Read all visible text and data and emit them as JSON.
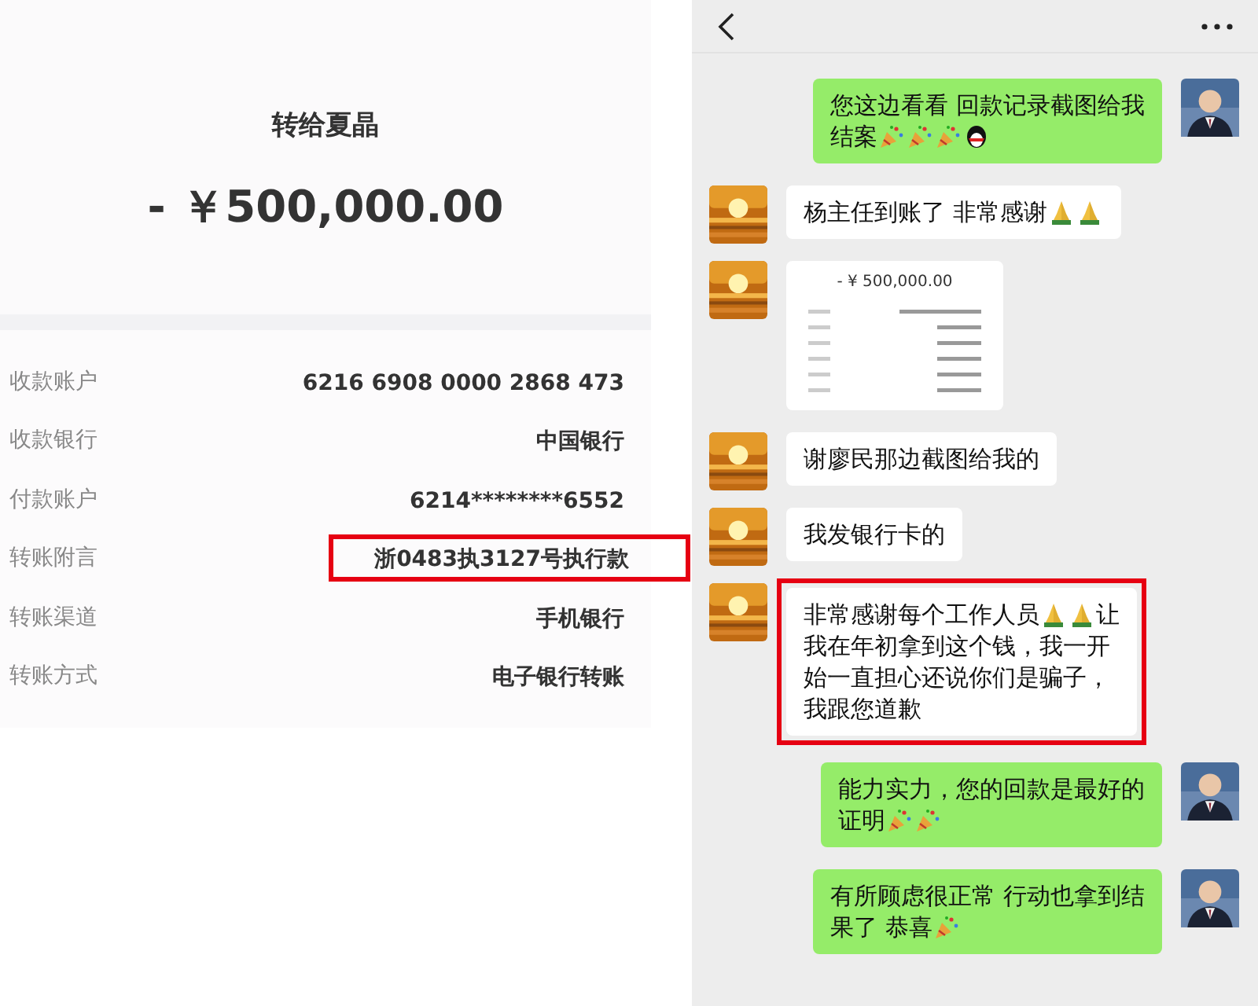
{
  "receipt": {
    "title": "转给夏晶",
    "amount": "- ￥500,000.00",
    "rows": [
      {
        "label": "收款账户",
        "value": "6216 6908 0000 2868 473",
        "highlighted": false
      },
      {
        "label": "收款银行",
        "value": "中国银行",
        "highlighted": false
      },
      {
        "label": "付款账户",
        "value": "6214********6552",
        "highlighted": false
      },
      {
        "label": "转账附言",
        "value": "浙0483执3127号执行款",
        "highlighted": true
      },
      {
        "label": "转账渠道",
        "value": "手机银行",
        "highlighted": false
      },
      {
        "label": "转账方式",
        "value": "电子银行转账",
        "highlighted": false
      }
    ]
  },
  "chat": {
    "messages": [
      {
        "outgoing": true,
        "kind": "text",
        "highlighted": false,
        "lines": [
          [
            {
              "kind": "text",
              "text": "您这边看看  回款记录截图给我"
            }
          ],
          [
            {
              "kind": "text",
              "text": "结案"
            },
            {
              "kind": "party"
            },
            {
              "kind": "party"
            },
            {
              "kind": "party"
            },
            {
              "kind": "penguin"
            }
          ]
        ]
      },
      {
        "outgoing": false,
        "kind": "text",
        "highlighted": false,
        "lines": [
          [
            {
              "kind": "text",
              "text": "杨主任到账了 非常感谢"
            },
            {
              "kind": "pray"
            },
            {
              "kind": "pray"
            }
          ]
        ]
      },
      {
        "outgoing": false,
        "kind": "screenshot",
        "highlighted": false,
        "amount": "- ¥ 500,000.00"
      },
      {
        "outgoing": false,
        "kind": "text",
        "highlighted": false,
        "lines": [
          [
            {
              "kind": "text",
              "text": "谢廖民那边截图给我的"
            }
          ]
        ]
      },
      {
        "outgoing": false,
        "kind": "text",
        "highlighted": false,
        "lines": [
          [
            {
              "kind": "text",
              "text": "我发银行卡的"
            }
          ]
        ]
      },
      {
        "outgoing": false,
        "kind": "text",
        "highlighted": true,
        "lines": [
          [
            {
              "kind": "text",
              "text": "非常感谢每个工作人员"
            },
            {
              "kind": "pray"
            },
            {
              "kind": "pray"
            },
            {
              "kind": "text",
              "text": "让"
            }
          ],
          [
            {
              "kind": "text",
              "text": "我在年初拿到这个钱，我一开"
            }
          ],
          [
            {
              "kind": "text",
              "text": "始一直担心还说你们是骗子，"
            }
          ],
          [
            {
              "kind": "text",
              "text": "我跟您道歉"
            }
          ]
        ]
      },
      {
        "outgoing": true,
        "kind": "text",
        "highlighted": false,
        "lines": [
          [
            {
              "kind": "text",
              "text": "能力实力，您的回款是最好的"
            }
          ],
          [
            {
              "kind": "text",
              "text": "证明"
            },
            {
              "kind": "party"
            },
            {
              "kind": "party"
            }
          ]
        ]
      },
      {
        "outgoing": true,
        "kind": "text",
        "highlighted": false,
        "lines": [
          [
            {
              "kind": "text",
              "text": "有所顾虑很正常  行动也拿到结"
            }
          ],
          [
            {
              "kind": "text",
              "text": "果了  恭喜"
            },
            {
              "kind": "party"
            }
          ]
        ]
      }
    ]
  }
}
